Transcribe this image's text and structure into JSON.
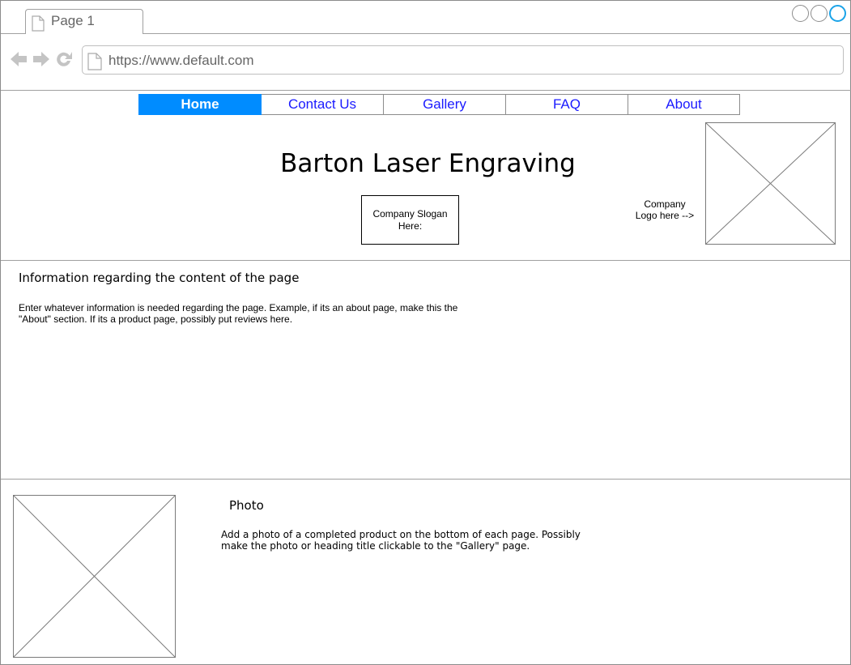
{
  "browser": {
    "tab_label": "Page 1",
    "url": "https://www.default.com",
    "window_controls": [
      "minimize-icon",
      "maximize-icon",
      "close-icon"
    ],
    "nav_icons": [
      "back-arrow-icon",
      "forward-arrow-icon",
      "reload-icon"
    ],
    "accent_color": "#1aa3e8"
  },
  "nav": {
    "items": [
      {
        "label": "Home",
        "active": true
      },
      {
        "label": "Contact Us",
        "active": false
      },
      {
        "label": "Gallery",
        "active": false
      },
      {
        "label": "FAQ",
        "active": false
      },
      {
        "label": "About",
        "active": false
      }
    ],
    "active_color": "#008cff",
    "link_color": "#1a1aff"
  },
  "header": {
    "title": "Barton Laser Engraving",
    "slogan": "Company Slogan Here:",
    "logo_note": "Company Logo here -->"
  },
  "info": {
    "heading": "Information regarding the content of the page",
    "body": "Enter whatever information is needed regarding the page. Example, if its an about page, make this the \"About\" section. If its a product page, possibly put reviews here."
  },
  "photo": {
    "heading": "Photo",
    "body": "Add a photo of a completed product on the bottom of each page. Possibly make the photo or heading title clickable to the \"Gallery\" page."
  }
}
